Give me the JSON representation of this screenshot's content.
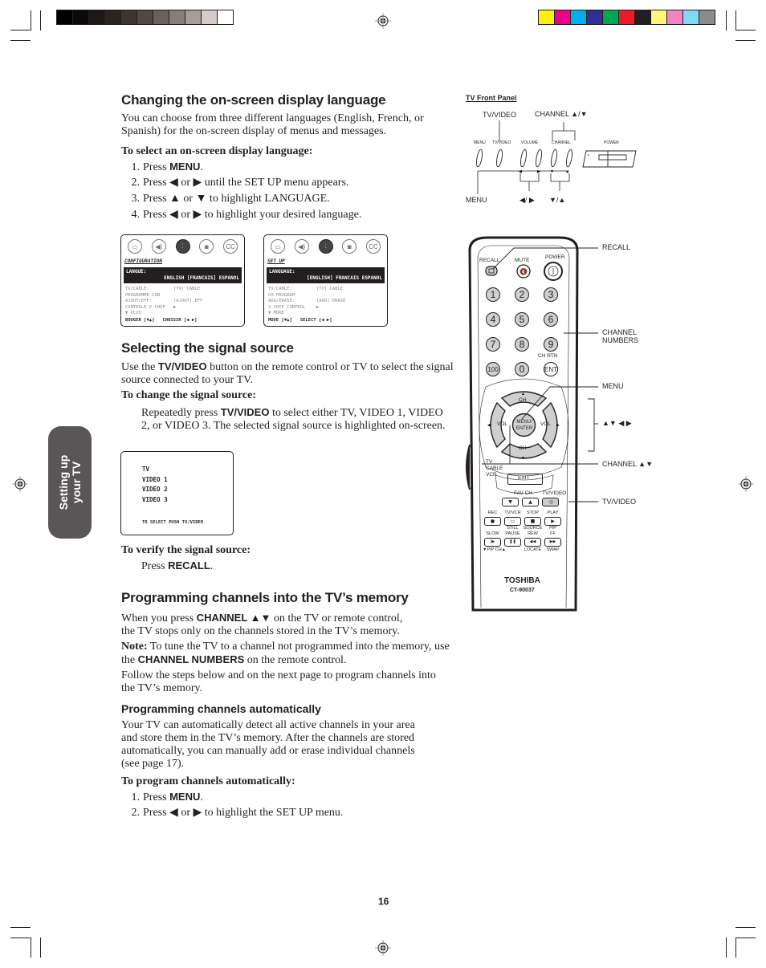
{
  "print_marks": {
    "gray_swatches": [
      "#000000",
      "#0c0a09",
      "#1b1715",
      "#2a2421",
      "#3d3331",
      "#514846",
      "#6a605d",
      "#877d7a",
      "#a69d9a",
      "#d5cbc8",
      "#ffffff"
    ],
    "color_swatches": [
      "#fff200",
      "#ec008c",
      "#00aeef",
      "#2e3192",
      "#00a651",
      "#ed1c24",
      "#231f20",
      "#fff77a",
      "#f283c4",
      "#81d8f7",
      "#8c8c8c"
    ]
  },
  "side_tab": {
    "line1": "Setting up",
    "line2": "your TV"
  },
  "section_language": {
    "heading": "Changing the on-screen display language",
    "intro": "You can choose from three different languages (English, French, or Spanish) for the on-screen display of menus and messages.",
    "subheading": "To select an on-screen display language:",
    "steps": [
      {
        "num": "1.",
        "pre": "Press ",
        "key": "MENU",
        "post": "."
      },
      {
        "num": "2.",
        "text": "Press ◀ or ▶ until the SET UP menu appears."
      },
      {
        "num": "3.",
        "text": "Press ▲ or ▼ to highlight LANGUAGE."
      },
      {
        "num": "4.",
        "text": "Press ◀ or ▶ to highlight your desired language."
      }
    ]
  },
  "osd_french": {
    "icons": [
      "picture-icon",
      "audio-icon",
      "setup-icon",
      "theater-icon",
      "cc-icon"
    ],
    "icon_glyphs": [
      "▭",
      "◀)",
      "⫶",
      "◙",
      "CC"
    ],
    "selected_icon_index": 2,
    "title": "CONFIGURATION",
    "highlight_label": "LANGUE:",
    "highlight_options": "ENGLISH [FRANCAIS] ESPANOL",
    "rows": [
      {
        "key": "TV/CABLE:",
        "value": "[TV] CABLE"
      },
      {
        "key": "PROGRAMME CAN",
        "value": ""
      },
      {
        "key": "AJOUT/EFF:",
        "value": "[AJOUT] EFF"
      },
      {
        "key": "CONTROLE V-CHIP",
        "value": "▶"
      },
      {
        "key": "▼ PLUS",
        "value": ""
      }
    ],
    "footer_move": "BOUGER [▼▲]",
    "footer_select": "CHOISIR [◀ ▶]"
  },
  "osd_english": {
    "icons": [
      "picture-icon",
      "audio-icon",
      "setup-icon",
      "theater-icon",
      "cc-icon"
    ],
    "icon_glyphs": [
      "▭",
      "◀)",
      "⫶",
      "◙",
      "CC"
    ],
    "selected_icon_index": 2,
    "title": "SET UP",
    "highlight_label": "LANGUAGE:",
    "highlight_options": "[ENGLISH] FRANCAIS ESPANOL",
    "rows": [
      {
        "key": "TV/CABLE:",
        "value": "[TV] CABLE"
      },
      {
        "key": "CH PROGRAM",
        "value": ""
      },
      {
        "key": "ADD/ERASE:",
        "value": "[ADD] ERASE"
      },
      {
        "key": "V-CHIP CONTROL",
        "value": "▶"
      },
      {
        "key": "▼ MORE",
        "value": ""
      }
    ],
    "footer_move": "MOVE [▼▲]",
    "footer_select": "SELECT [◀ ▶]"
  },
  "section_signal": {
    "heading": "Selecting the signal source",
    "intro_pre": "Use the ",
    "intro_key": "TV/VIDEO",
    "intro_post": " button on the remote control or TV to select the signal source connected to your TV.",
    "sub_change": "To change the signal source:",
    "change_pre": "Repeatedly press ",
    "change_key": "TV/VIDEO",
    "change_post": " to select either TV, VIDEO 1, VIDEO 2, or VIDEO 3. The selected signal source is highlighted on-screen.",
    "sub_verify": "To verify the signal source:",
    "verify_pre": "Press ",
    "verify_key": "RECALL",
    "verify_post": "."
  },
  "osd_sources": {
    "items": [
      "TV",
      "VIDEO 1",
      "VIDEO 2",
      "VIDEO 3"
    ],
    "footer": "TO SELECT PUSH TV/VIDEO"
  },
  "section_programming": {
    "heading": "Programming channels into the TV’s memory",
    "p1_pre": "When you press ",
    "p1_key": "CHANNEL ▲▼",
    "p1_post": " on the TV or remote control, the TV stops only on the channels stored in the TV’s memory.",
    "note_label": "Note:",
    "note_pre": " To tune the TV to a channel not programmed into the memory, use the ",
    "note_key": "CHANNEL NUMBERS",
    "note_post": " on the remote control.",
    "p3": "Follow the steps below and on the next page to program channels into the TV’s memory.",
    "subsection_heading": "Programming channels automatically",
    "auto_intro": "Your TV can automatically detect all active channels in your area and store them in the TV’s memory. After the channels are stored automatically, you can manually add or erase individual channels (see page 17).",
    "auto_sub": "To program channels automatically:",
    "steps": [
      {
        "num": "1.",
        "pre": "Press ",
        "key": "MENU",
        "post": "."
      },
      {
        "num": "2.",
        "text": "Press ◀ or ▶ to highlight the SET UP menu."
      }
    ]
  },
  "front_panel": {
    "title": "TV Front Panel",
    "callout_tvvideo": "TV/VIDEO",
    "callout_channel": "CHANNEL ▲/▼",
    "callout_menu": "MENU",
    "callout_volume": "◀/ ▶",
    "callout_channel_arrows": "▼/▲",
    "small_labels": [
      "MENU",
      "TV/VIDEO",
      "VOLUME",
      "CHANNEL",
      "POWER"
    ]
  },
  "remote": {
    "top_buttons": [
      "RECALL",
      "MUTE",
      "POWER"
    ],
    "number_keys": [
      "1",
      "2",
      "3",
      "4",
      "5",
      "6",
      "7",
      "8",
      "9",
      "100",
      "0",
      "ENT"
    ],
    "ch_rtn": "CH RTN",
    "dpad_up": "CH",
    "dpad_down": "CH",
    "dpad_left": "VOL",
    "dpad_right": "VOL",
    "dpad_center": "MENU/ ENTER",
    "mode_switch": [
      "TV",
      "CABLE",
      "VCR"
    ],
    "exit": "EXIT",
    "fav_ch": "FAV CH",
    "tv_video": "TV/VIDEO",
    "vcr_row1_labels": [
      "REC",
      "TV/VCR",
      "STOP",
      "PLAY"
    ],
    "vcr_row2_top": [
      "",
      "STILL",
      "SOURCE",
      "PIP"
    ],
    "vcr_row2_labels": [
      "SLOW",
      "PAUSE",
      "REW",
      "FF"
    ],
    "vcr_row2_bottom": [
      "▼PIP CH▲",
      "",
      "LOCATE",
      "SWAP"
    ],
    "brand": "TOSHIBA",
    "model": "CT-90037"
  },
  "remote_callouts": {
    "recall": "RECALL",
    "channel_numbers": "CHANNEL NUMBERS",
    "menu": "MENU",
    "arrows": "▲▼ ◀ ▶",
    "channel": "CHANNEL ▲▼",
    "tv_video": "TV/VIDEO"
  },
  "page_number": "16"
}
